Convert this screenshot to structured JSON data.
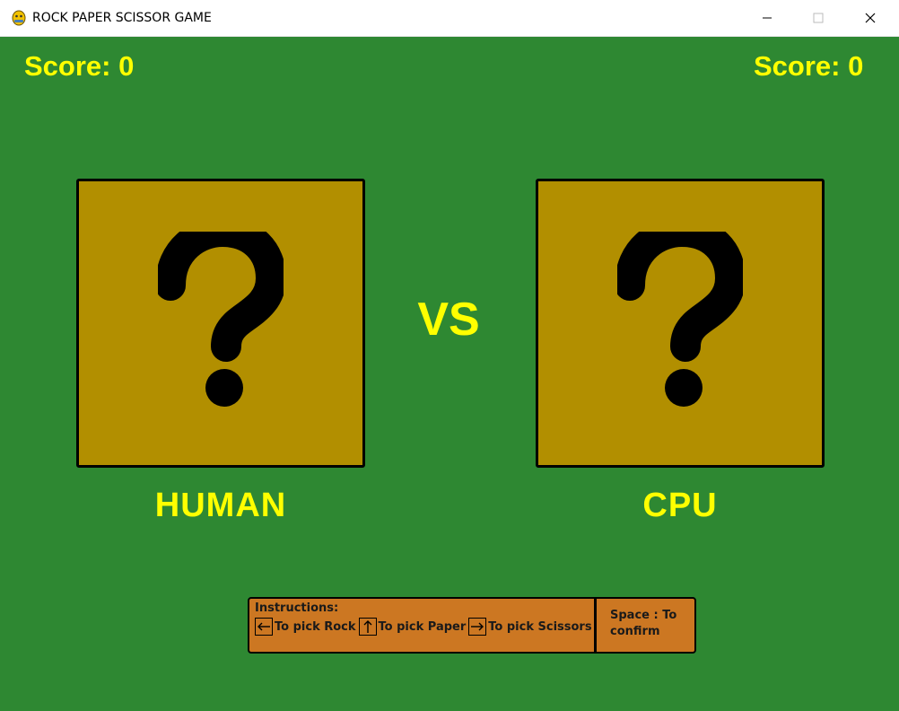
{
  "window": {
    "title": "ROCK PAPER SCISSOR GAME",
    "icon": "python-icon"
  },
  "scores": {
    "human": "Score: 0",
    "cpu": "Score: 0"
  },
  "cards": {
    "human_symbol": "question-mark-icon",
    "cpu_symbol": "question-mark-icon",
    "card_color": "#b28f00"
  },
  "vs_label": "VS",
  "players": {
    "human": "HUMAN",
    "cpu": "CPU"
  },
  "instructions": {
    "title": "Instructions:",
    "rock": "To pick Rock",
    "paper": "To pick Paper",
    "scissors": "To pick Scissors",
    "confirm": "Space : To confirm"
  },
  "colors": {
    "background": "#2e8832",
    "accent_text": "#ffff00",
    "instructions_bg": "#cc7722"
  }
}
